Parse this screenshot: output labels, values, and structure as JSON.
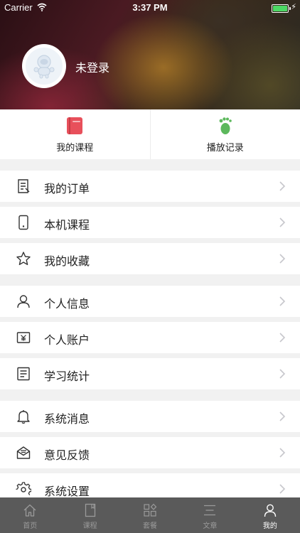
{
  "status_bar": {
    "carrier": "Carrier",
    "time": "3:37 PM"
  },
  "profile": {
    "login_status": "未登录"
  },
  "quick_actions": [
    {
      "label": "我的课程",
      "icon": "red-book-icon",
      "color": "#e8505b"
    },
    {
      "label": "播放记录",
      "icon": "green-footprint-icon",
      "color": "#5cb85c"
    }
  ],
  "menu": [
    {
      "label": "我的订单",
      "icon": "order-icon"
    },
    {
      "label": "本机课程",
      "icon": "phone-icon"
    },
    {
      "label": "我的收藏",
      "icon": "star-icon"
    },
    {
      "label": "个人信息",
      "icon": "user-icon"
    },
    {
      "label": "个人账户",
      "icon": "wallet-icon"
    },
    {
      "label": "学习统计",
      "icon": "stats-icon"
    },
    {
      "label": "系统消息",
      "icon": "bell-icon"
    },
    {
      "label": "意见反馈",
      "icon": "feedback-icon"
    },
    {
      "label": "系统设置",
      "icon": "settings-icon"
    }
  ],
  "tabbar": {
    "active": "我的",
    "items": [
      {
        "label": "首页",
        "icon": "home-icon"
      },
      {
        "label": "课程",
        "icon": "book-icon"
      },
      {
        "label": "套餐",
        "icon": "grid-icon"
      },
      {
        "label": "文章",
        "icon": "article-icon"
      },
      {
        "label": "我的",
        "icon": "profile-icon"
      }
    ]
  },
  "colors": {
    "tabbar_bg": "#5a5a5a",
    "page_bg": "#f1f1f1"
  }
}
